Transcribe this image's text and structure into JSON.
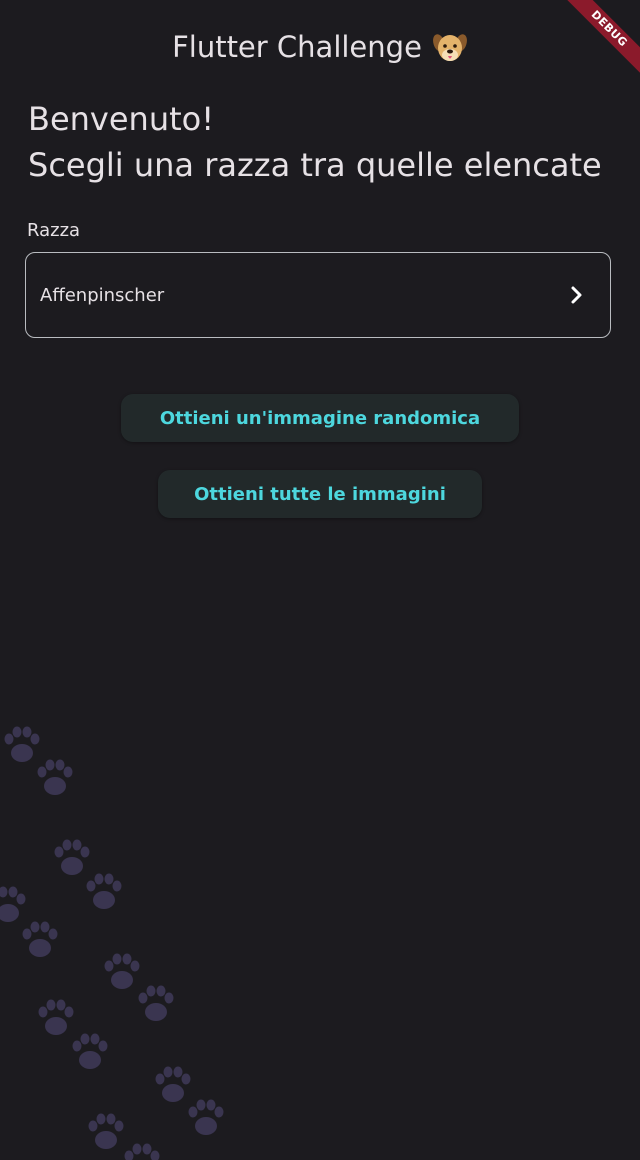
{
  "debug_banner": "DEBUG",
  "app_bar": {
    "title": "Flutter Challenge",
    "icon": "dog-face-icon"
  },
  "welcome": {
    "line1": "Benvenuto!",
    "line2": "Scegli una razza tra quelle elencate"
  },
  "breed_field": {
    "label": "Razza",
    "value": "Affenpinscher",
    "icon": "chevron-right-icon"
  },
  "buttons": {
    "random_image": "Ottieni un'immagine randomica",
    "all_images": "Ottieni tutte le immagini"
  },
  "colors": {
    "background": "#1c1b1f",
    "accent": "#4dd7de",
    "button_bg": "#22292a",
    "paw": "#3a3550",
    "debug_ribbon": "#8b1a2b"
  },
  "decoration": {
    "icon": "paw-print-icon"
  }
}
